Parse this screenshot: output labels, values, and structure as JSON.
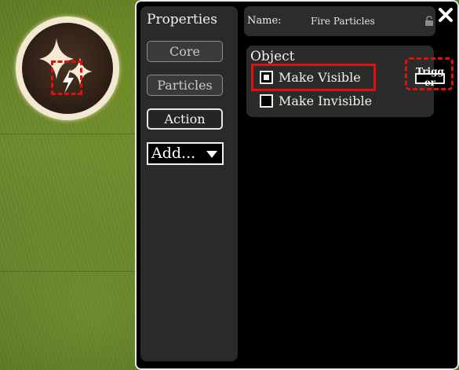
{
  "sidebar": {
    "title": "Properties",
    "buttons": [
      {
        "label": "Core"
      },
      {
        "label": "Particles"
      },
      {
        "label": "Action"
      }
    ],
    "add_select": {
      "value": "Add..."
    }
  },
  "header": {
    "name_label": "Name:",
    "name_value": "Fire Particles"
  },
  "object_section": {
    "title": "Object",
    "options": [
      {
        "label": "Make Visible",
        "checked": true
      },
      {
        "label": "Make Invisible",
        "checked": false
      }
    ],
    "trigger_label": "Trigger"
  },
  "icons": {
    "object": "sparkle-lightning-icon",
    "lock": "lock-icon",
    "close": "close-icon"
  },
  "colors": {
    "highlight": "#e01010",
    "panel_bg": "#000000",
    "section_bg": "#2b2b2b"
  }
}
